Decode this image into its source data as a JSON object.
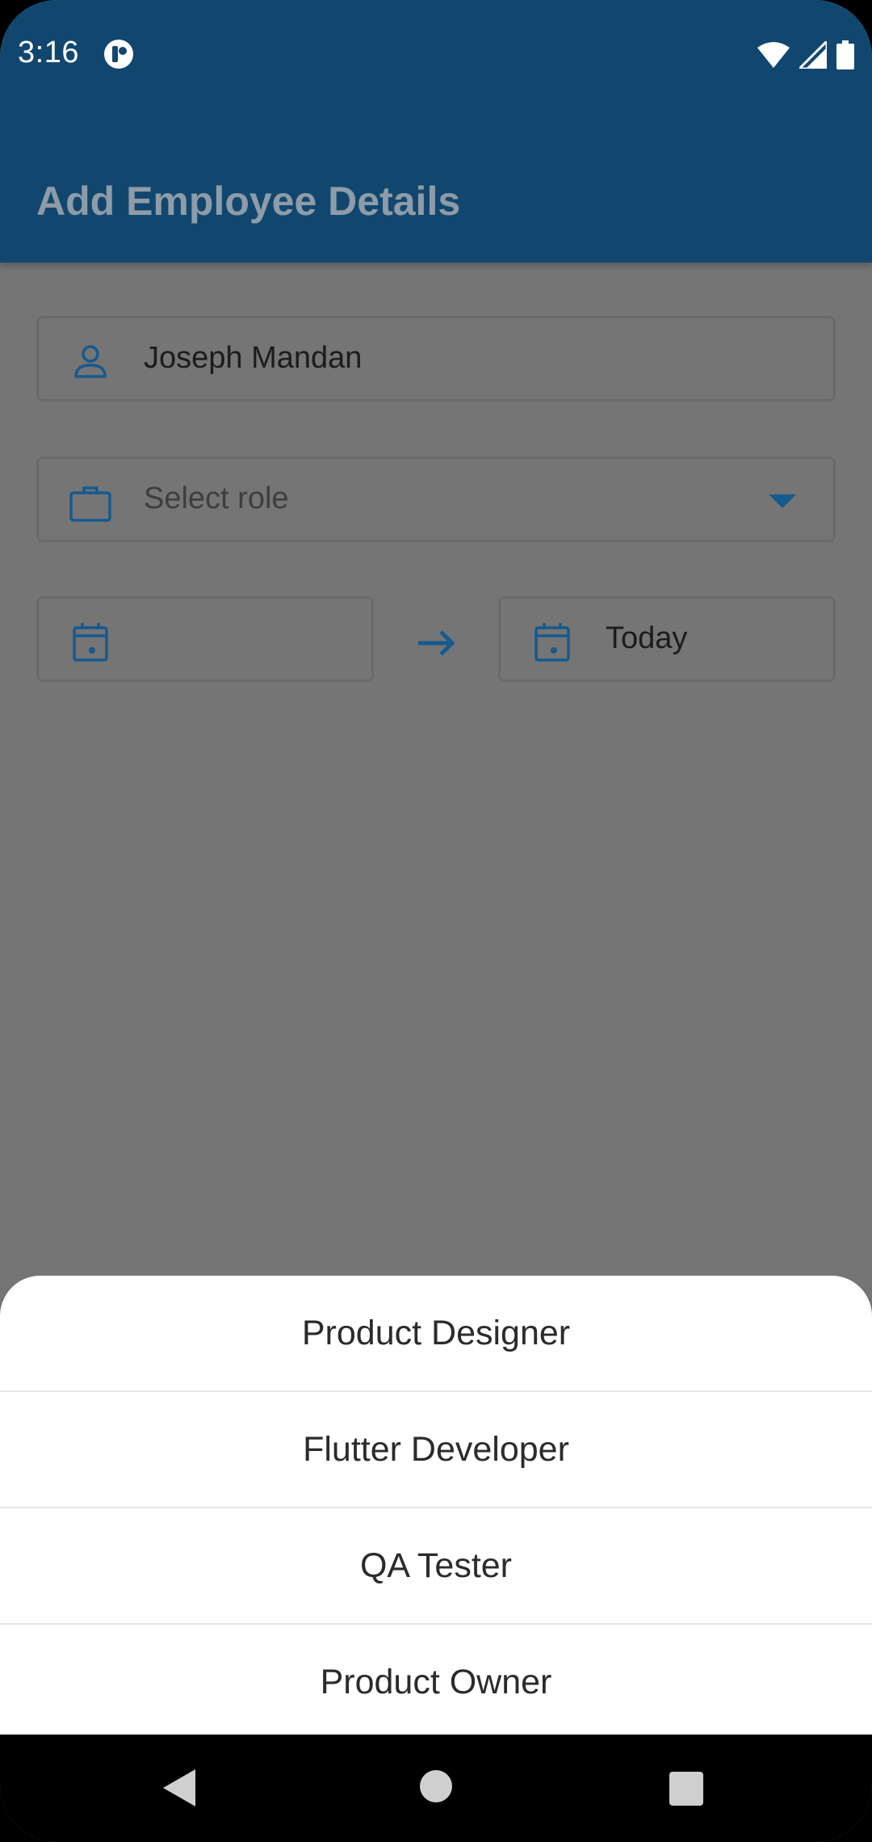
{
  "status_bar": {
    "time": "3:16",
    "icons": [
      "app-notification-icon",
      "wifi-icon",
      "cell-signal-icon",
      "battery-icon"
    ]
  },
  "app_bar": {
    "title": "Add Employee Details"
  },
  "form": {
    "name_field": {
      "value": "Joseph Mandan",
      "icon": "person-icon"
    },
    "role_field": {
      "placeholder": "Select role",
      "icon": "briefcase-icon"
    },
    "start_date_field": {
      "value": "",
      "icon": "calendar-icon"
    },
    "end_date_field": {
      "value": "Today",
      "icon": "calendar-icon"
    }
  },
  "role_sheet": {
    "options": [
      "Product Designer",
      "Flutter Developer",
      "QA Tester",
      "Product Owner"
    ]
  },
  "colors": {
    "app_bar": "#11476F",
    "accent": "#165A8E",
    "scrim_background": "#757575",
    "sheet_background": "#FFFFFF"
  }
}
